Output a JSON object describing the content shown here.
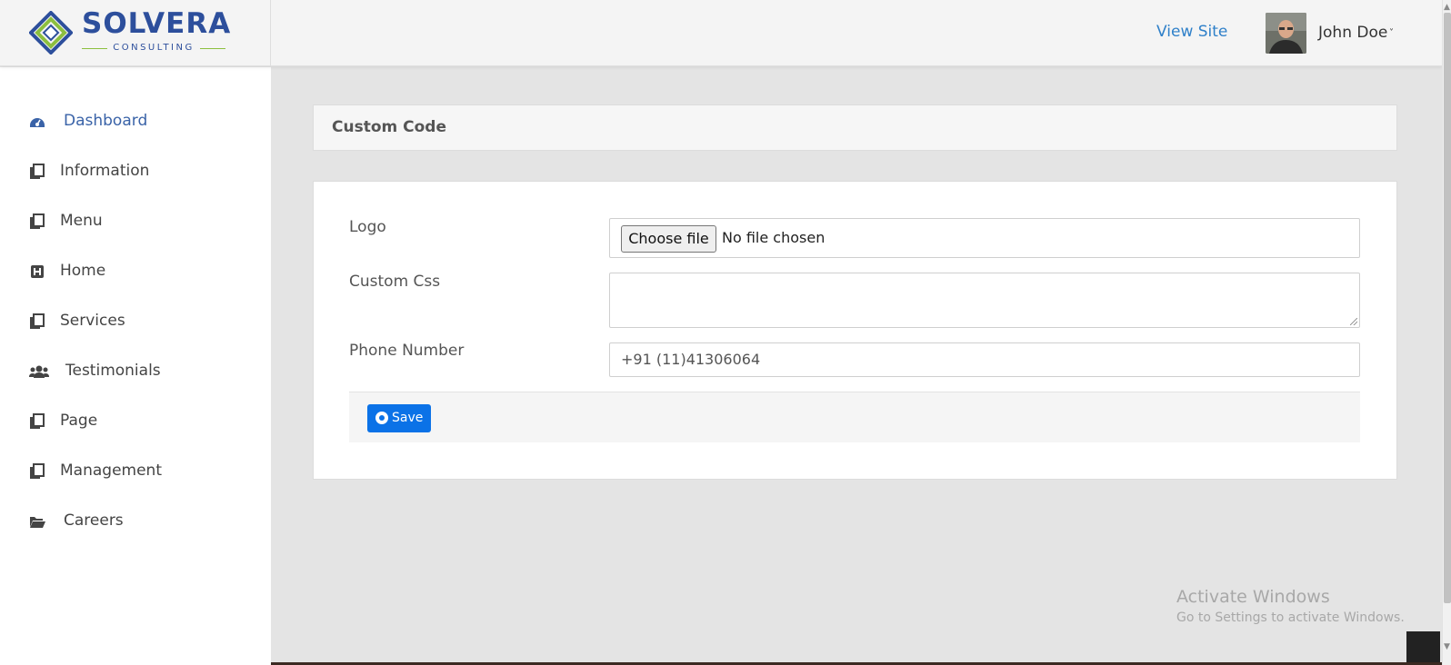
{
  "brand": {
    "name": "SOLVERA",
    "tagline": "CONSULTING"
  },
  "header": {
    "view_site": "View Site",
    "user_name": "John Doe"
  },
  "sidebar": {
    "items": [
      {
        "label": "Dashboard",
        "icon": "dashboard-icon",
        "active": true
      },
      {
        "label": "Information",
        "icon": "copy-icon"
      },
      {
        "label": "Menu",
        "icon": "copy-icon"
      },
      {
        "label": "Home",
        "icon": "h-square-icon"
      },
      {
        "label": "Services",
        "icon": "copy-icon"
      },
      {
        "label": "Testimonials",
        "icon": "users-icon"
      },
      {
        "label": "Page",
        "icon": "copy-icon"
      },
      {
        "label": "Management",
        "icon": "copy-icon"
      },
      {
        "label": "Careers",
        "icon": "folder-open-icon"
      }
    ]
  },
  "page": {
    "title": "Custom Code"
  },
  "form": {
    "logo_label": "Logo",
    "file_button": "Choose file",
    "file_status": "No file chosen",
    "css_label": "Custom Css",
    "css_value": "",
    "phone_label": "Phone Number",
    "phone_value": "+91 (11)41306064",
    "save_label": "Save"
  },
  "watermark": {
    "title": "Activate Windows",
    "subtitle": "Go to Settings to activate Windows."
  },
  "colors": {
    "accent": "#0b72e7",
    "link": "#2f80c9",
    "brand": "#2d4f9c",
    "brand_green": "#8cbf3f"
  }
}
